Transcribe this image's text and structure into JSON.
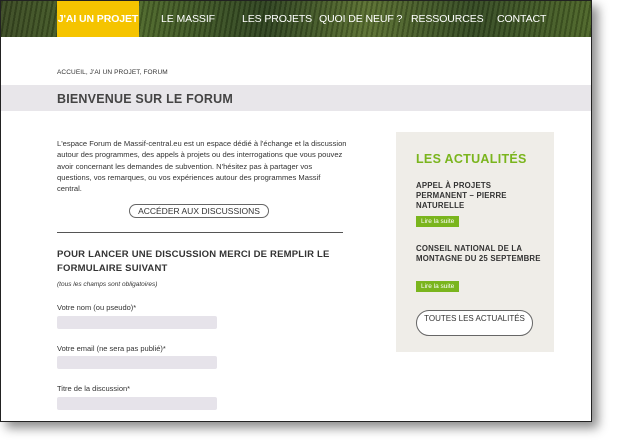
{
  "nav": {
    "items": [
      {
        "label": "J'AI UN PROJET",
        "active": true
      },
      {
        "label": "LE MASSIF"
      },
      {
        "label": "LES PROJETS"
      },
      {
        "label": "QUOI DE NEUF ?"
      },
      {
        "label": "RESSOURCES"
      },
      {
        "label": "CONTACT"
      }
    ],
    "active_color": "#f5c400"
  },
  "breadcrumb": "ACCUEIL, J'AI UN PROJET, FORUM",
  "page_title": "BIENVENUE SUR LE FORUM",
  "intro": "L'espace Forum de Massif-central.eu est un espace dédié à l'échange et la discussion autour des programmes, des appels à projets ou des interrogations que vous pouvez avoir concernant les demandes de subvention. N'hésitez pas à partager vos questions, vos remarques, ou vos expériences autour des programmes Massif central.",
  "access_button": "ACCÉDER AUX DISCUSSIONS",
  "form": {
    "heading": "POUR LANCER UNE DISCUSSION MERCI DE REMPLIR LE FORMULAIRE SUIVANT",
    "required_note": "(tous les champs sont obligatoires)",
    "fields": [
      {
        "label": "Votre nom (ou pseudo)*",
        "value": ""
      },
      {
        "label": "Votre email (ne sera pas publié)*",
        "value": ""
      },
      {
        "label": "Titre de la discussion*",
        "value": ""
      }
    ]
  },
  "news": {
    "heading": "LES ACTUALITÉS",
    "accent_color": "#7ab51d",
    "items": [
      {
        "title": "APPEL À PROJETS PERMANENT – PIERRE NATURELLE",
        "link": "Lire la suite"
      },
      {
        "title": "CONSEIL NATIONAL DE LA MONTAGNE DU 25 SEPTEMBRE",
        "link": "Lire la suite"
      }
    ],
    "all_button": "TOUTES LES ACTUALITÉS"
  }
}
